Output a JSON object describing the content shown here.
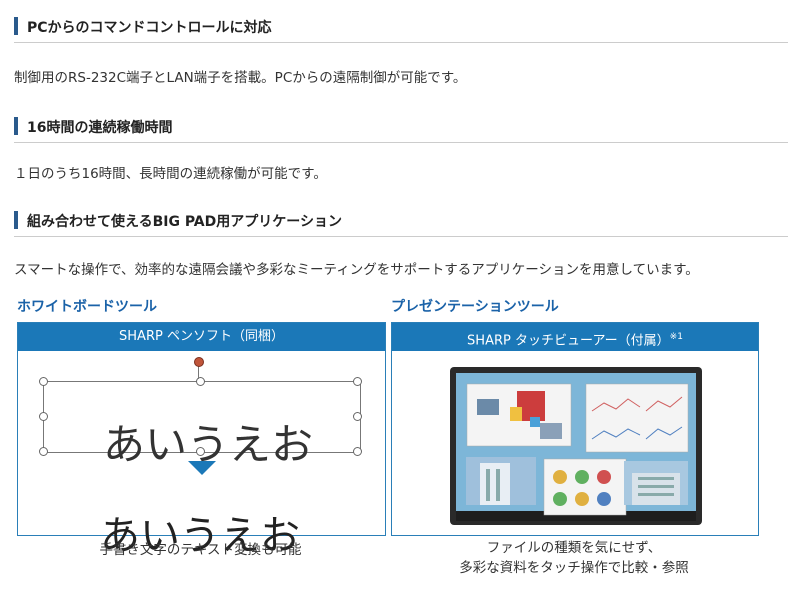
{
  "sections": [
    {
      "heading": "PCからのコマンドコントロールに対応",
      "text": "制御用のRS-232C端子とLAN端子を搭載。PCからの遠隔制御が可能です。"
    },
    {
      "heading": "16時間の連続稼働時間",
      "text": "１日のうち16時間、長時間の連続稼働が可能です。"
    },
    {
      "heading": "組み合わせて使えるBIG PAD用アプリケーション",
      "text": "スマートな操作で、効率的な遠隔会議や多彩なミーティングをサポートするアプリケーションを用意しています。"
    }
  ],
  "apps": [
    {
      "title": "ホワイトボードツール",
      "panel_header": "SHARP ペンソフト（同梱）",
      "handwritten": "あいうえお",
      "converted": "あいうえお",
      "caption": "手書き文字のテキスト変換も可能"
    },
    {
      "title": "プレゼンテーションツール",
      "panel_header": "SHARP タッチビューアー（付属）",
      "footnote_mark": "※1",
      "caption_line1": "ファイルの種類を気にせず、",
      "caption_line2": "多彩な資料をタッチ操作で比較・参照"
    }
  ],
  "colors": {
    "accent_bar": "#2a5a8c",
    "panel_header": "#1b78b8",
    "subtitle": "#1a62a8",
    "arrow": "#1b78b8"
  }
}
